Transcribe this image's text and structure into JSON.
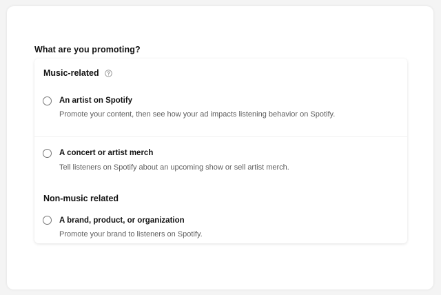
{
  "form": {
    "question": "What are you promoting?"
  },
  "groups": {
    "music": {
      "title": "Music-related",
      "help_icon": "question-circle-icon"
    },
    "non_music": {
      "title": "Non-music related"
    }
  },
  "options": [
    {
      "label": "An artist on Spotify",
      "description": "Promote your content, then see how your ad impacts listening behavior on Spotify.",
      "selected": false
    },
    {
      "label": "A concert or artist merch",
      "description": "Tell listeners on Spotify about an upcoming show or sell artist merch.",
      "selected": false
    },
    {
      "label": "A brand, product, or organization",
      "description": "Promote your brand to listeners on Spotify.",
      "selected": false
    }
  ],
  "colors": {
    "text": "#121212",
    "subtext": "#5e5e5e",
    "radio_border": "#757575",
    "background": "#f4f4f4"
  }
}
